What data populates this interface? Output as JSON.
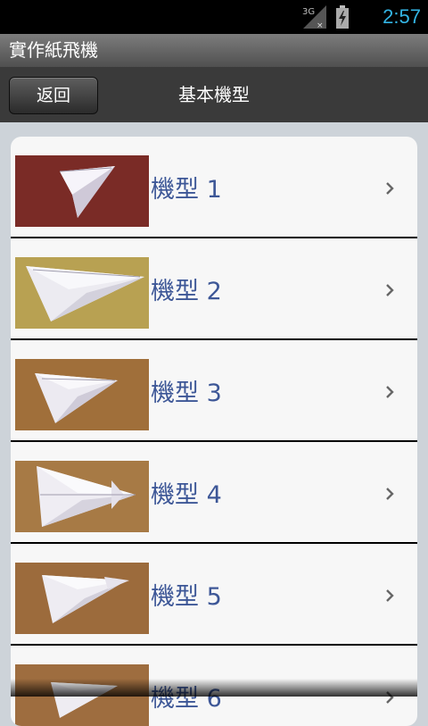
{
  "status": {
    "network": "3G",
    "time": "2:57"
  },
  "app": {
    "title": "實作紙飛機"
  },
  "navbar": {
    "back_label": "返回",
    "title": "基本機型"
  },
  "list": {
    "items": [
      {
        "label": "機型 1",
        "thumb_bg": "#7a2b26"
      },
      {
        "label": "機型 2",
        "thumb_bg": "#b8a152"
      },
      {
        "label": "機型 3",
        "thumb_bg": "#a06f3a"
      },
      {
        "label": "機型 4",
        "thumb_bg": "#a77a45"
      },
      {
        "label": "機型 5",
        "thumb_bg": "#9c6b3c"
      },
      {
        "label": "機型 6",
        "thumb_bg": "#9e6d3f"
      }
    ]
  }
}
